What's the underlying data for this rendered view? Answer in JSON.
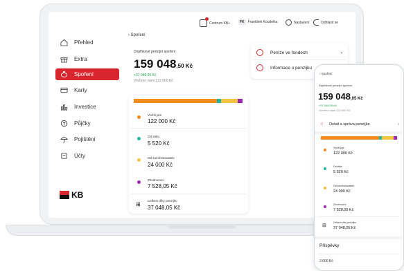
{
  "header": {
    "centrum": "Centrum KB+",
    "user_initials": "FK",
    "user_name": "František Koudelka",
    "settings": "Nastavení",
    "logout": "Odhlásit se"
  },
  "sidebar": {
    "items": [
      {
        "label": "Přehled",
        "icon": "home-icon"
      },
      {
        "label": "Extra",
        "icon": "gift-icon"
      },
      {
        "label": "Spoření",
        "icon": "piggy-bank-icon"
      },
      {
        "label": "Karty",
        "icon": "card-icon"
      },
      {
        "label": "Investice",
        "icon": "chart-icon"
      },
      {
        "label": "Půjčky",
        "icon": "loan-icon"
      },
      {
        "label": "Pojištění",
        "icon": "umbrella-icon"
      },
      {
        "label": "Účty",
        "icon": "accounts-icon"
      }
    ],
    "active_index": 2,
    "logo": "KB"
  },
  "main": {
    "back": "Spoření",
    "product": "Doplňkové penzijní spoření",
    "amount_main": "159 048",
    "amount_sub": ",50 Kč",
    "gain": "+37 048,05 Kč",
    "deposited": "Vloženo vámi 122 000 Kč",
    "actions": [
      {
        "label": "Peníze ve fondech",
        "icon": "clock-icon"
      },
      {
        "label": "Informace o penzijku",
        "icon": "info-icon"
      }
    ],
    "rows": [
      {
        "label": "Vložili jste",
        "value": "122 000 Kč",
        "color": "#f28a1c"
      },
      {
        "label": "Od státu",
        "value": "5 520 Kč",
        "color": "#22b8a0"
      },
      {
        "label": "Od zaměstnavatele",
        "value": "24 000 Kč",
        "color": "#f5c542"
      },
      {
        "label": "Zhodnocení",
        "value": "7 528,05 Kč",
        "color": "#9c27b0"
      }
    ],
    "total_label": "Celkem díky penzijku",
    "total_value": "37 048,05 Kč"
  },
  "phone": {
    "back": "Spoření",
    "product": "Doplňkové penzijní spoření",
    "amount_main": "159 048",
    "amount_sub": ",05 Kč",
    "gain": "+37 048,05 Kč",
    "deposited": "Vloženo vámi 122 000 Kč",
    "detail": "Detail a správa penzijka",
    "rows": [
      {
        "label": "Vložili jste",
        "value": "122 000 Kč",
        "color": "#f28a1c"
      },
      {
        "label": "Od státu",
        "value": "5 520 Kč",
        "color": "#22b8a0"
      },
      {
        "label": "Od zaměstnavatele",
        "value": "24 000 Kč",
        "color": "#f5c542"
      },
      {
        "label": "Zhodnocení",
        "value": "7 528,05 Kč",
        "color": "#9c27b0"
      }
    ],
    "total_label": "Celkem díky penzijku",
    "total_value": "37 048,05 Kč",
    "contrib_title": "Příspěvky",
    "contrib_value": "3 000 Kč"
  },
  "colors": {
    "brand_red": "#d7262e",
    "orange": "#f28a1c",
    "teal": "#22b8a0",
    "yellow": "#f5c542",
    "purple": "#9c27b0",
    "gain_green": "#1e9e4a"
  }
}
